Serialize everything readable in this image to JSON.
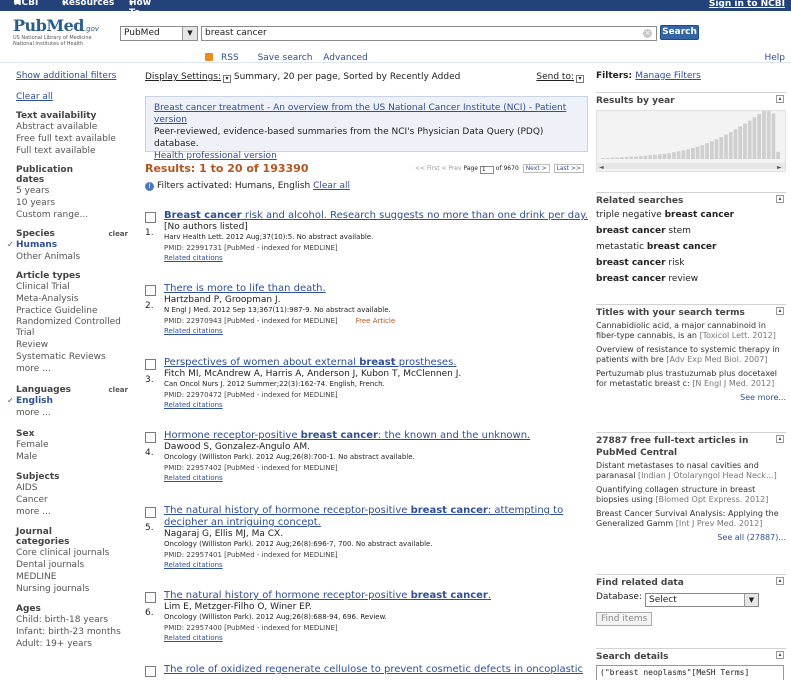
{
  "topbar": {
    "ncbi": "NCBI",
    "resources": "Resources",
    "howto": "How To",
    "signin": "Sign in to NCBI"
  },
  "logo": {
    "text": "PubMed",
    "gov": ".gov",
    "line1": "US National Library of Medicine",
    "line2": "National Institutes of Health"
  },
  "search": {
    "db": "PubMed",
    "query": "breast cancer",
    "button": "Search",
    "rss": "RSS",
    "save": "Save search",
    "advanced": "Advanced",
    "help": "Help"
  },
  "left": {
    "show_filters": "Show additional filters",
    "clear_all": "Clear all",
    "text_avail": {
      "title": "Text availability",
      "items": [
        "Abstract available",
        "Free full text available",
        "Full text available"
      ]
    },
    "pub_dates": {
      "title": "Publication dates",
      "items": [
        "5 years",
        "10 years",
        "Custom range..."
      ]
    },
    "species": {
      "title": "Species",
      "clear": "clear",
      "items": [
        "Humans",
        "Other Animals"
      ]
    },
    "article_types": {
      "title": "Article types",
      "items": [
        "Clinical Trial",
        "Meta-Analysis",
        "Practice Guideline",
        "Randomized Controlled Trial",
        "Review",
        "Systematic Reviews",
        "more ..."
      ]
    },
    "languages": {
      "title": "Languages",
      "clear": "clear",
      "items": [
        "English",
        "more ..."
      ]
    },
    "sex": {
      "title": "Sex",
      "items": [
        "Female",
        "Male"
      ]
    },
    "subjects": {
      "title": "Subjects",
      "items": [
        "AIDS",
        "Cancer",
        "more ..."
      ]
    },
    "journals": {
      "title": "Journal categories",
      "items": [
        "Core clinical journals",
        "Dental journals",
        "MEDLINE",
        "Nursing journals"
      ]
    },
    "ages": {
      "title": "Ages",
      "items": [
        "Child: birth-18 years",
        "Infant: birth-23 months",
        "Adult: 19+ years"
      ]
    }
  },
  "main": {
    "display_settings": "Display Settings:",
    "display_value": "Summary, 20 per page, Sorted by Recently Added",
    "send_to": "Send to:",
    "ad": {
      "link": "Breast cancer treatment - An overview from the US National Cancer Institute (NCI) - Patient version",
      "text": "Peer-reviewed, evidence-based summaries from the NCI's Physician Data Query (PDQ) database.",
      "link2": "Health professional version"
    },
    "results_count": "Results: 1 to 20 of 193390",
    "pager": {
      "first": "<< First",
      "prev": "< Prev",
      "page_label": "Page",
      "page": "1",
      "of": "of 9670",
      "next": "Next >",
      "last": "Last >>"
    },
    "filters_text": "Filters activated: Humans, English",
    "filters_clear": "Clear all",
    "results": [
      {
        "num": "1.",
        "title_a": "Breast cancer",
        "title_b": " risk and alcohol. Research suggests no more than one drink per day.",
        "authors": "[No authors listed]",
        "journal": "Harv Health Lett. 2012 Aug;37(10):5. No abstract available.",
        "pmid": "PMID: 22991731 [PubMed - indexed for MEDLINE]",
        "free": "",
        "rel": "Related citations"
      },
      {
        "num": "2.",
        "title_a": "There is more to life than death.",
        "title_b": "",
        "authors": "Hartzband P, Groopman J.",
        "journal": "N Engl J Med. 2012 Sep 13;367(11):987-9. No abstract available.",
        "pmid": "PMID: 22970943 [PubMed - indexed for MEDLINE]",
        "free": "Free Article",
        "rel": "Related citations"
      },
      {
        "num": "3.",
        "title_a": "Perspectives of women about external ",
        "title_b": "breast",
        "title_c": " prostheses.",
        "authors": "Fitch MI, McAndrew A, Harris A, Anderson J, Kubon T, McClennen J.",
        "journal": "Can Oncol Nurs J. 2012 Summer;22(3):162-74. English, French.",
        "pmid": "PMID: 22970472 [PubMed - indexed for MEDLINE]",
        "free": "",
        "rel": "Related citations"
      },
      {
        "num": "4.",
        "title_a": "Hormone receptor-positive ",
        "title_b": "breast cancer",
        "title_c": ": the known and the unknown.",
        "authors": "Dawood S, Gonzalez-Angulo AM.",
        "journal": "Oncology (Williston Park). 2012 Aug;26(8):700-1. No abstract available.",
        "pmid": "PMID: 22957402 [PubMed - indexed for MEDLINE]",
        "free": "",
        "rel": "Related citations"
      },
      {
        "num": "5.",
        "title_a": "The natural history of hormone receptor-positive ",
        "title_b": "breast cancer",
        "title_c": ": attempting to decipher an intriguing concept.",
        "authors": "Nagaraj G, Ellis MJ, Ma CX.",
        "journal": "Oncology (Williston Park). 2012 Aug;26(8):696-7, 700. No abstract available.",
        "pmid": "PMID: 22957401 [PubMed - indexed for MEDLINE]",
        "free": "",
        "rel": "Related citations"
      },
      {
        "num": "6.",
        "title_a": "The natural history of hormone receptor-positive ",
        "title_b": "breast cancer",
        "title_c": ".",
        "authors": "Lim E, Metzger-Filho O, Winer EP.",
        "journal": "Oncology (Williston Park). 2012 Aug;26(8):688-94, 696. Review.",
        "pmid": "PMID: 22957400 [PubMed - indexed for MEDLINE]",
        "free": "",
        "rel": "Related citations"
      },
      {
        "num": "7.",
        "title_a": "The role of oxidized regenerate cellulose to prevent cosmetic defects in oncoplastic",
        "title_b": "",
        "title_c": "",
        "authors": "",
        "journal": "",
        "pmid": "",
        "free": "",
        "rel": ""
      }
    ]
  },
  "right": {
    "filters_label": "Filters:",
    "manage": "Manage Filters",
    "by_year": "Results by year",
    "year_bars": [
      2,
      2,
      3,
      3,
      4,
      4,
      5,
      5,
      6,
      7,
      8,
      9,
      10,
      11,
      12,
      14,
      16,
      18,
      20,
      23,
      26,
      29,
      33,
      37,
      41,
      46,
      51,
      56,
      62,
      68,
      74,
      80,
      87,
      94,
      100,
      100,
      95,
      15
    ],
    "related_title": "Related searches",
    "related": [
      {
        "a": "triple negative ",
        "b": "breast cancer",
        "c": ""
      },
      {
        "a": "",
        "b": "breast cancer",
        "c": " stem"
      },
      {
        "a": "metastatic ",
        "b": "breast cancer",
        "c": ""
      },
      {
        "a": "",
        "b": "breast cancer",
        "c": " risk"
      },
      {
        "a": "",
        "b": "breast cancer",
        "c": " review"
      }
    ],
    "titles_title": "Titles with your search terms",
    "titles": [
      {
        "t": "Cannabidiolic acid, a major cannabinoid in fiber-type cannabis, is an ",
        "src": "[Toxicol Lett. 2012]"
      },
      {
        "t": "Overview of resistance to systemic therapy in patients with bre ",
        "src": "[Adv Exp Med Biol. 2007]"
      },
      {
        "t": "Pertuzumab plus trastuzumab plus docetaxel for metastatic breast c: ",
        "src": "[N Engl J Med. 2012]"
      }
    ],
    "see_more": "See more...",
    "free_title": "27887 free full-text articles in PubMed Central",
    "free": [
      {
        "t": "Distant metastases to nasal cavities and paranasal ",
        "src": "[Indian J Otolaryngol Head Neck...]"
      },
      {
        "t": "Quantifying collagen structure in breast biopsies using ",
        "src": "[Biomed Opt Express. 2012]"
      },
      {
        "t": "Breast Cancer Survival Analysis: Applying the Generalized Gamm ",
        "src": "[Int J Prev Med. 2012]"
      }
    ],
    "see_all": "See all (27887)...",
    "find_title": "Find related data",
    "database_label": "Database:",
    "db_select": "Select",
    "find_btn": "Find items",
    "details_title": "Search details",
    "details_text": "(\"breast neoplasms\"[MeSH Terms]"
  }
}
